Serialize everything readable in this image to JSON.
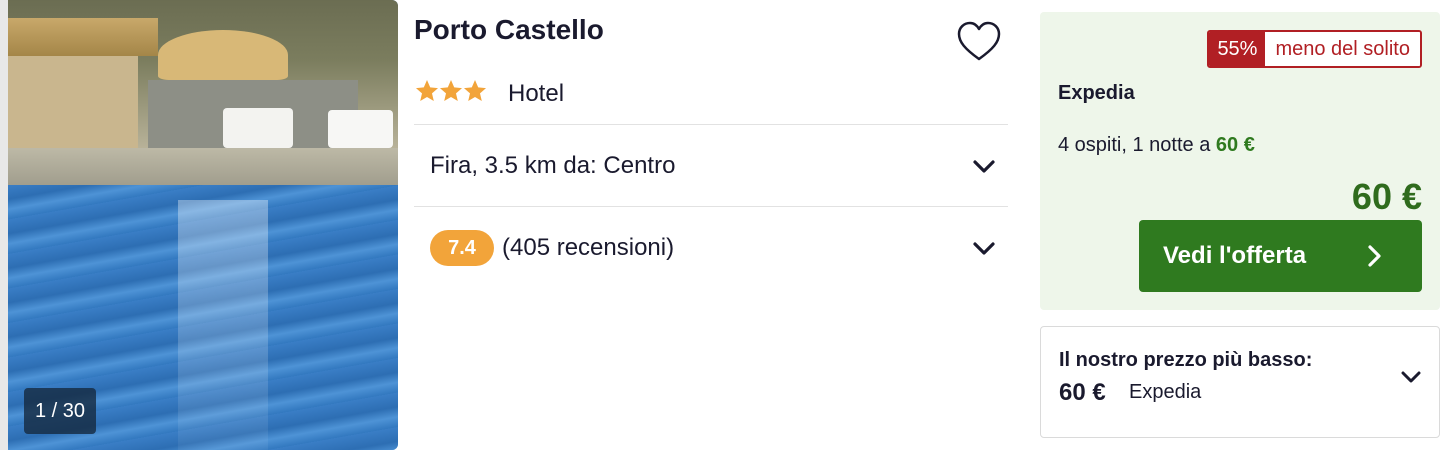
{
  "photo": {
    "counter": "1 / 30"
  },
  "hotel": {
    "name": "Porto Castello",
    "stars": 3,
    "type": "Hotel",
    "location": "Fira, 3.5 km da: Centro",
    "rating": "7.4",
    "reviews": "(405 recensioni)"
  },
  "deal": {
    "discount_pct": "55%",
    "discount_label": "meno del solito",
    "provider": "Expedia",
    "guests_text": "4 ospiti, 1 notte a ",
    "guests_price": "60 €",
    "price": "60 €",
    "cta_label": "Vedi l'offerta"
  },
  "lowest": {
    "title": "Il nostro prezzo più basso:",
    "price": "60 €",
    "provider": "Expedia"
  },
  "colors": {
    "accent_green": "#2f7a1f",
    "discount_red": "#b11f24",
    "rating_orange": "#f2a43a",
    "star_orange": "#f2a43a",
    "deal_bg": "#eef6ea"
  },
  "icons": {
    "favorite": "heart-outline-icon",
    "star": "star-icon",
    "expand": "chevron-down-icon",
    "cta": "chevron-right-icon"
  }
}
